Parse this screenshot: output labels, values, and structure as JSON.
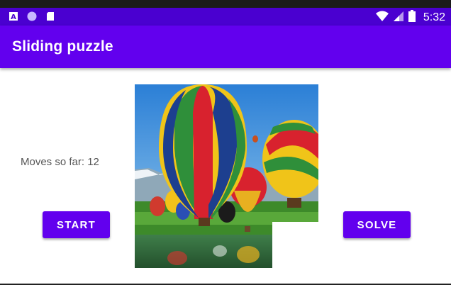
{
  "status_bar": {
    "time": "5:32",
    "left_icons": [
      "a-notification-icon",
      "circle-notification-icon",
      "sd-card-icon"
    ],
    "right_icons": [
      "wifi-icon",
      "cell-signal-icon",
      "battery-icon"
    ]
  },
  "app_bar": {
    "title": "Sliding puzzle"
  },
  "game": {
    "moves_text": "Moves so far: 12",
    "start_label": "START",
    "solve_label": "SOLVE",
    "puzzle_image": "hot-air-balloons",
    "empty_tile": "bottom-right"
  },
  "colors": {
    "primary": "#6200ee",
    "status_bar": "#4a00d0"
  }
}
